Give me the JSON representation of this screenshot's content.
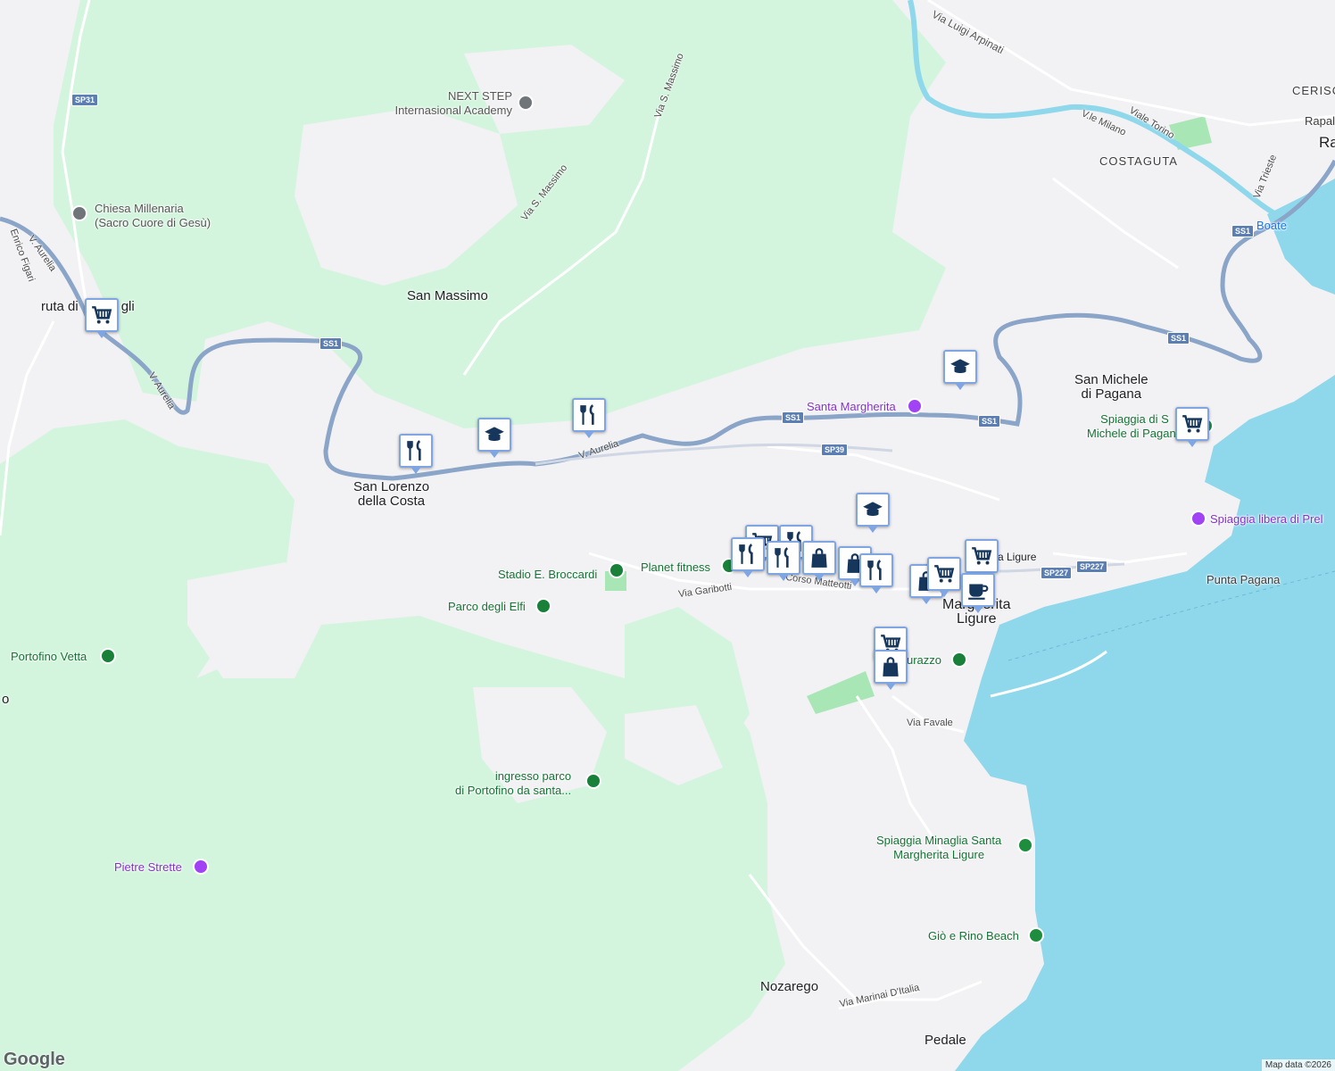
{
  "colors": {
    "land": "#f2f1f4",
    "park": "#d3f5dd",
    "water": "#8fd8ec",
    "road_primary": "#8aa5c8",
    "road_minor": "#ffffff",
    "pin_border": "#7fa6e2",
    "pin_icon": "#16365c"
  },
  "labels": {
    "via_luigi_arpinati": "Via Luigi Arpinati",
    "ceriso": "CERISC",
    "rapal": "Rapal",
    "ra": "Ra",
    "viale_torino": "Viale Torino",
    "vle_milano": "V.le Milano",
    "costaguta": "COSTAGUTA",
    "via_trieste": "Via Trieste",
    "boate": "Boate",
    "next_step_1": "NEXT STEP",
    "next_step_2": "Internasional Academy",
    "via_s_massimo_1": "Via S. Massimo",
    "via_s_massimo_2": "Via S. Massimo",
    "chiesa_1": "Chiesa Millenaria",
    "chiesa_2": "(Sacro Cuore di Gesù)",
    "v_aurelia_1": "V. Aurelia",
    "v_aurelia_2": "V. Aurelia",
    "v_aurelia_3": "V. Aurelia",
    "enrico_figari": "Enrico Figari",
    "ruta_di_gli": "ruta di",
    "ruta_gli_suffix": "gli",
    "san_massimo": "San Massimo",
    "santa_margherita_cam": "Santa Margherita",
    "san_michele_1": "San Michele",
    "san_michele_2": "di Pagana",
    "spiaggia_sm_1": "Spiaggia di S",
    "spiaggia_sm_2": "Michele di Pagana",
    "san_lorenzo_1": "San Lorenzo",
    "san_lorenzo_2": "della Costa",
    "spiaggia_libera": "Spiaggia libera di Prel",
    "stadio": "Stadio E. Broccardi",
    "planet_fitness": "Planet fitness",
    "via_garibotti": "Via Garibotti",
    "corso_matteotti": "Corso Matteotti",
    "santa_margherita_ligure_st": "a Ligure",
    "punta_pagana": "Punta Pagana",
    "parco_elfi": "Parco degli Elfi",
    "portofino_vetta": "Portofino Vetta",
    "o_left": "o",
    "sm_ligure_1": "Margherita",
    "sm_ligure_2": "Ligure",
    "durazzo": "urazzo",
    "via_favale": "Via Favale",
    "ingresso_1": "ingresso parco",
    "ingresso_2": "di Portofino da santa...",
    "pietre_strette": "Pietre Strette",
    "minaglia_1": "Spiaggia Minaglia Santa",
    "minaglia_2": "Margherita Ligure",
    "gio_rino": "Giò e Rino Beach",
    "nozarego": "Nozarego",
    "via_marinai": "Via Marinai D'Italia",
    "pedale": "Pedale"
  },
  "road_shields": [
    "SP31",
    "SS1",
    "SS1",
    "SS1",
    "SP39",
    "SS1",
    "SS1",
    "SP227",
    "SP227"
  ],
  "markers": [
    {
      "icon": "cart-icon"
    },
    {
      "icon": "restaurant-icon"
    },
    {
      "icon": "school-icon"
    },
    {
      "icon": "restaurant-icon"
    },
    {
      "icon": "school-icon"
    },
    {
      "icon": "cart-icon"
    },
    {
      "icon": "school-icon"
    },
    {
      "icon": "cart-icon"
    },
    {
      "icon": "restaurant-icon"
    },
    {
      "icon": "restaurant-icon"
    },
    {
      "icon": "restaurant-icon"
    },
    {
      "icon": "bag-icon"
    },
    {
      "icon": "bag-icon"
    },
    {
      "icon": "restaurant-icon"
    },
    {
      "icon": "cart-icon"
    },
    {
      "icon": "bag-icon"
    },
    {
      "icon": "cart-icon"
    },
    {
      "icon": "coffee-icon"
    },
    {
      "icon": "cart-icon"
    },
    {
      "icon": "bag-icon"
    }
  ],
  "brand": "Google",
  "attribution": "Map data ©2026"
}
